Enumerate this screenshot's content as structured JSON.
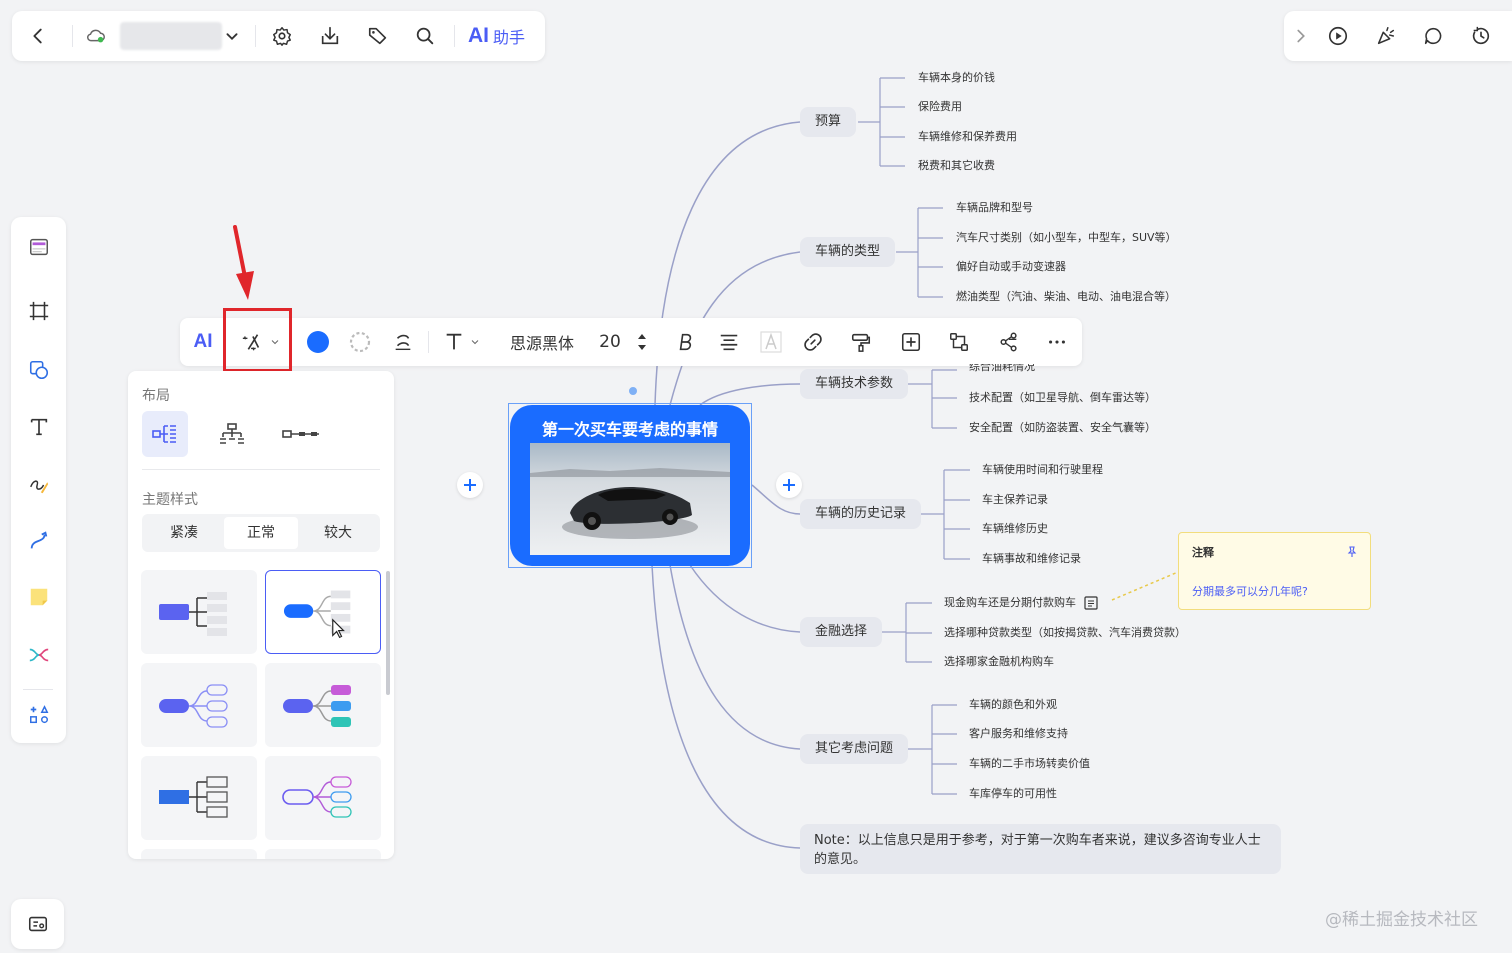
{
  "topbar": {
    "back_icon": "chevron-left-icon",
    "cloud_icon": "cloud-sync-icon",
    "doc_title": "",
    "ai_label": "AI",
    "assistant_label": "助手"
  },
  "topright": {
    "icons": [
      "chevron-right-icon",
      "play-icon",
      "celebrate-icon",
      "comment-icon",
      "history-icon"
    ]
  },
  "sidebar": {
    "tools": [
      "template-icon",
      "frame-icon",
      "shape-icon",
      "text-icon",
      "pen-icon",
      "connector-icon",
      "sticky-note-icon",
      "mindmap-icon",
      "more-shapes-icon"
    ]
  },
  "float_toolbar": {
    "ai_label": "AI",
    "font_name": "思源黑体",
    "font_size": "20",
    "fill_color": "#1a6cff"
  },
  "layout_panel": {
    "layout_heading": "布局",
    "style_heading": "主题样式",
    "density": [
      "紧凑",
      "正常",
      "较大"
    ],
    "selected_density": "正常"
  },
  "mindmap": {
    "root": "第一次买车要考虑的事情",
    "branches": [
      {
        "label": "预算",
        "leaves": [
          "车辆本身的价钱",
          "保险费用",
          "车辆维修和保养费用",
          "税费和其它收费"
        ]
      },
      {
        "label": "车辆的类型",
        "leaves": [
          "车辆品牌和型号",
          "汽车尺寸类别（如小型车，中型车，SUV等）",
          "偏好自动或手动变速器",
          "燃油类型（汽油、柴油、电动、油电混合等）"
        ]
      },
      {
        "label": "车辆技术参数",
        "leaves": [
          "综合油耗情况",
          "技术配置（如卫星导航、倒车雷达等）",
          "安全配置（如防盗装置、安全气囊等）"
        ]
      },
      {
        "label": "车辆的历史记录",
        "leaves": [
          "车辆使用时间和行驶里程",
          "车主保养记录",
          "车辆维修历史",
          "车辆事故和维修记录"
        ]
      },
      {
        "label": "金融选择",
        "leaves": [
          "现金购车还是分期付款购车",
          "选择哪种贷款类型（如按揭贷款、汽车消费贷款）",
          "选择哪家金融机构购车"
        ]
      },
      {
        "label": "其它考虑问题",
        "leaves": [
          "车辆的颜色和外观",
          "客户服务和维修支持",
          "车辆的二手市场转卖价值",
          "车库停车的可用性"
        ]
      }
    ],
    "note": "Note：以上信息只是用于参考，对于第一次购车者来说，建议多咨询专业人士的意见。"
  },
  "annotation": {
    "title": "注释",
    "text": "分期最多可以分几年呢?"
  },
  "watermark": "@稀土掘金技术社区"
}
